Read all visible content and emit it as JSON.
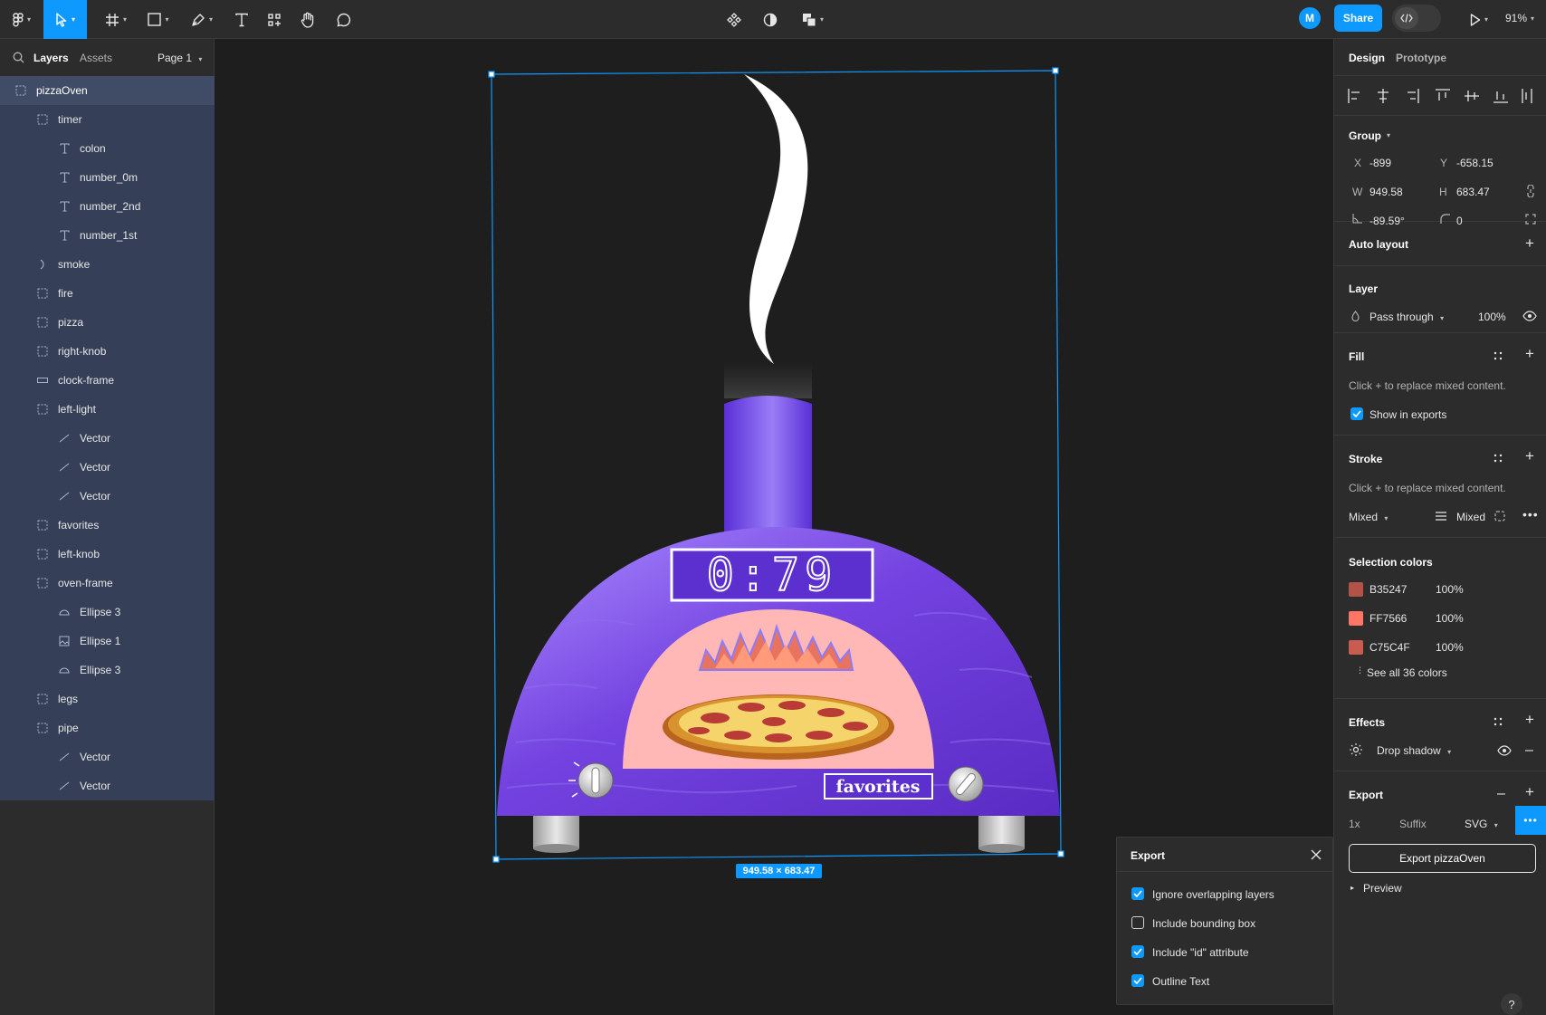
{
  "toolbar": {
    "zoom": "91%",
    "avatar_initial": "M",
    "share_label": "Share"
  },
  "left_panel": {
    "tabs": [
      "Layers",
      "Assets"
    ],
    "page": "Page 1",
    "layers": [
      {
        "name": "pizzaOven",
        "icon": "frame-icon",
        "indent": 0,
        "selected": true
      },
      {
        "name": "timer",
        "icon": "frame-icon",
        "indent": 1
      },
      {
        "name": "colon",
        "icon": "text-icon",
        "indent": 2
      },
      {
        "name": "number_0m",
        "icon": "text-icon",
        "indent": 2
      },
      {
        "name": "number_2nd",
        "icon": "text-icon",
        "indent": 2
      },
      {
        "name": "number_1st",
        "icon": "text-icon",
        "indent": 2
      },
      {
        "name": "smoke",
        "icon": "path-icon",
        "indent": 1
      },
      {
        "name": "fire",
        "icon": "frame-icon",
        "indent": 1
      },
      {
        "name": "pizza",
        "icon": "frame-icon",
        "indent": 1
      },
      {
        "name": "right-knob",
        "icon": "frame-icon",
        "indent": 1
      },
      {
        "name": "clock-frame",
        "icon": "rect-icon",
        "indent": 1
      },
      {
        "name": "left-light",
        "icon": "frame-icon",
        "indent": 1
      },
      {
        "name": "Vector",
        "icon": "line-icon",
        "indent": 2
      },
      {
        "name": "Vector",
        "icon": "line-icon",
        "indent": 2
      },
      {
        "name": "Vector",
        "icon": "line-icon",
        "indent": 2
      },
      {
        "name": "favorites",
        "icon": "frame-icon",
        "indent": 1
      },
      {
        "name": "left-knob",
        "icon": "frame-icon",
        "indent": 1
      },
      {
        "name": "oven-frame",
        "icon": "frame-icon",
        "indent": 1
      },
      {
        "name": "Ellipse 3",
        "icon": "ellipse-icon",
        "indent": 2
      },
      {
        "name": "Ellipse 1",
        "icon": "image-icon",
        "indent": 2
      },
      {
        "name": "Ellipse 3",
        "icon": "ellipse-icon",
        "indent": 2
      },
      {
        "name": "legs",
        "icon": "frame-icon",
        "indent": 1
      },
      {
        "name": "pipe",
        "icon": "frame-icon",
        "indent": 1
      },
      {
        "name": "Vector",
        "icon": "line-icon",
        "indent": 2
      },
      {
        "name": "Vector",
        "icon": "line-icon",
        "indent": 2
      }
    ]
  },
  "canvas": {
    "timer_text": "0:79",
    "favorites_text": "favorites",
    "dimensions_label": "949.58 × 683.47"
  },
  "right_panel": {
    "tabs": {
      "design": "Design",
      "prototype": "Prototype"
    },
    "group_label": "Group",
    "x_label": "X",
    "x_value": "-899",
    "y_label": "Y",
    "y_value": "-658.15",
    "w_label": "W",
    "w_value": "949.58",
    "h_label": "H",
    "h_value": "683.47",
    "rotation_value": "-89.59°",
    "radius_value": "0",
    "auto_layout": "Auto layout",
    "layer_title": "Layer",
    "blend_mode": "Pass through",
    "opacity": "100%",
    "fill_title": "Fill",
    "fill_mixed": "Click + to replace mixed content.",
    "show_in_exports": "Show in exports",
    "stroke_title": "Stroke",
    "stroke_mixed": "Click + to replace mixed content.",
    "stroke_style": "Mixed",
    "stroke_weight": "Mixed",
    "selection_colors_title": "Selection colors",
    "selection_colors": [
      {
        "hex": "B35247",
        "opacity": "100%",
        "color": "#B35247"
      },
      {
        "hex": "FF7566",
        "opacity": "100%",
        "color": "#FF7566"
      },
      {
        "hex": "C75C4F",
        "opacity": "100%",
        "color": "#C75C4F"
      }
    ],
    "see_all_colors": "See all 36 colors",
    "effects_title": "Effects",
    "effect_name": "Drop shadow",
    "export_title": "Export",
    "export_scale": "1x",
    "export_suffix": "Suffix",
    "export_format": "SVG",
    "export_button": "Export pizzaOven",
    "preview_label": "Preview"
  },
  "export_dialog": {
    "title": "Export",
    "options": [
      {
        "label": "Ignore overlapping layers",
        "checked": true
      },
      {
        "label": "Include bounding box",
        "checked": false
      },
      {
        "label": "Include \"id\" attribute",
        "checked": true
      },
      {
        "label": "Outline Text",
        "checked": true
      }
    ]
  },
  "colors": {
    "accent": "#0d99ff",
    "layer_highlight": "#354058"
  }
}
